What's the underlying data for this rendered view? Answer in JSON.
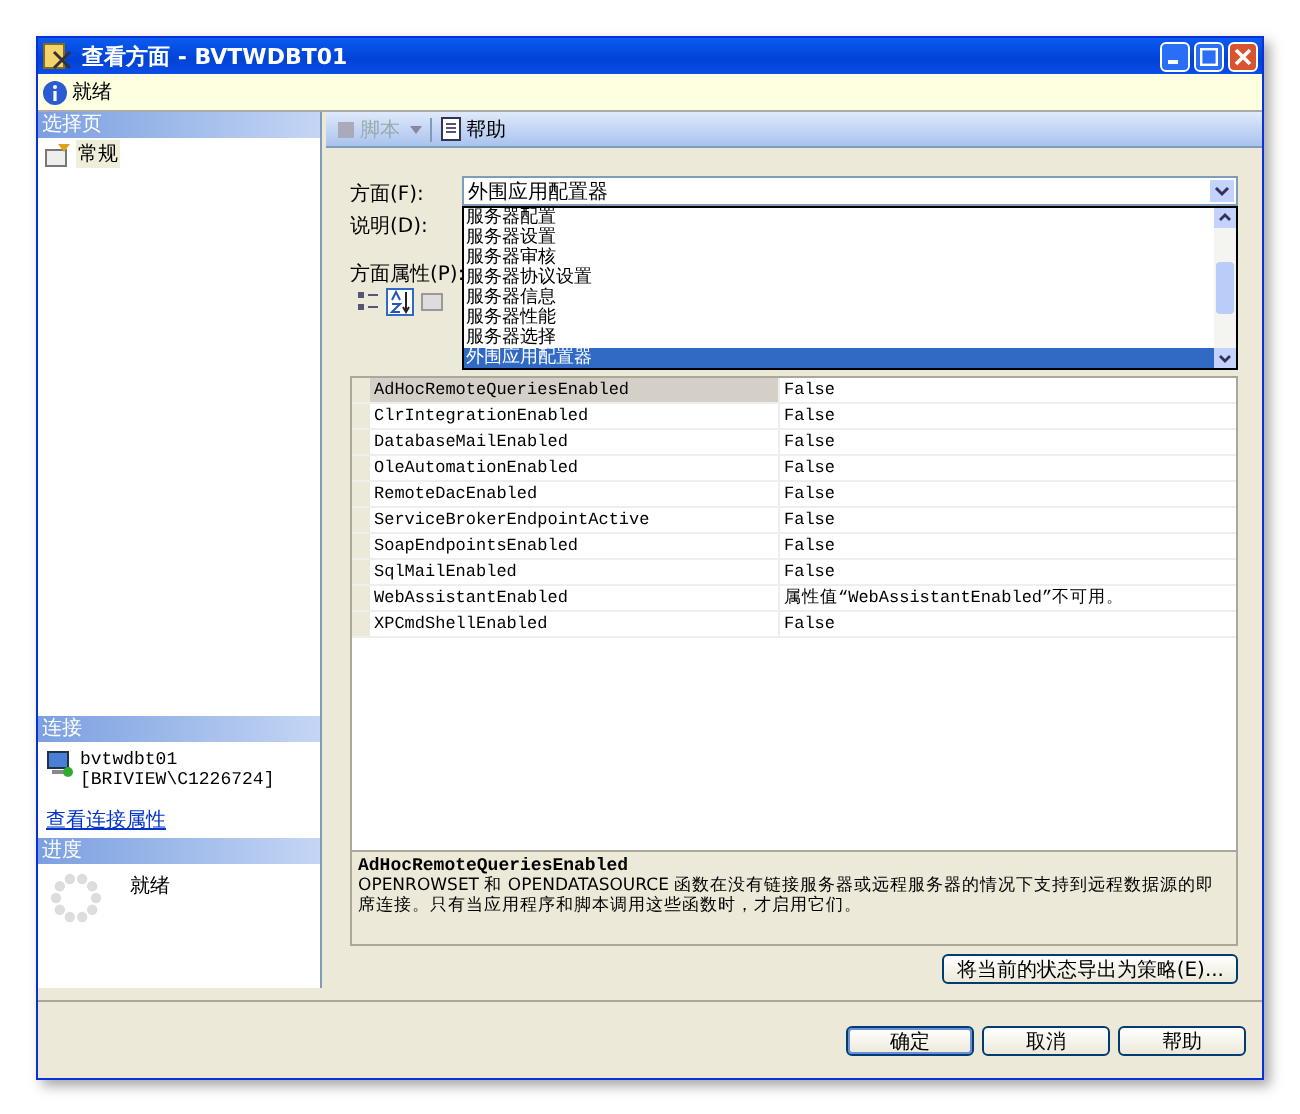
{
  "window": {
    "title": "查看方面 - BVTWDBT01"
  },
  "info_bar": {
    "text": "就绪"
  },
  "sidebar": {
    "pages_header": "选择页",
    "pages": [
      {
        "label": "常规",
        "selected": true
      }
    ],
    "connection_header": "连接",
    "connection": {
      "server": "bvtwdbt01",
      "user": "[BRIVIEW\\C1226724]"
    },
    "connection_link": "查看连接属性",
    "progress_header": "进度",
    "progress_status": "就绪"
  },
  "toolbar": [
    {
      "label": "脚本",
      "disabled": true,
      "kind": "script"
    },
    {
      "label": "帮助",
      "disabled": false,
      "kind": "help"
    }
  ],
  "form": {
    "facet_label": "方面(F):",
    "facet_value": "外围应用配置器",
    "description_label": "说明(D):",
    "properties_label": "方面属性(P):"
  },
  "dropdown": [
    {
      "label": "服务器配置",
      "selected": false
    },
    {
      "label": "服务器设置",
      "selected": false
    },
    {
      "label": "服务器审核",
      "selected": false
    },
    {
      "label": "服务器协议设置",
      "selected": false
    },
    {
      "label": "服务器信息",
      "selected": false
    },
    {
      "label": "服务器性能",
      "selected": false
    },
    {
      "label": "服务器选择",
      "selected": false
    },
    {
      "label": "外围应用配置器",
      "selected": true
    }
  ],
  "property_view": [
    {
      "kind": "categorized",
      "selected": false
    },
    {
      "kind": "alphabetical",
      "selected": true
    },
    {
      "kind": "pages",
      "selected": false
    }
  ],
  "properties": [
    {
      "name": "AdHocRemoteQueriesEnabled",
      "value": "False",
      "selected": true
    },
    {
      "name": "ClrIntegrationEnabled",
      "value": "False",
      "selected": false
    },
    {
      "name": "DatabaseMailEnabled",
      "value": "False",
      "selected": false
    },
    {
      "name": "OleAutomationEnabled",
      "value": "False",
      "selected": false
    },
    {
      "name": "RemoteDacEnabled",
      "value": "False",
      "selected": false
    },
    {
      "name": "ServiceBrokerEndpointActive",
      "value": "False",
      "selected": false
    },
    {
      "name": "SoapEndpointsEnabled",
      "value": "False",
      "selected": false
    },
    {
      "name": "SqlMailEnabled",
      "value": "False",
      "selected": false
    },
    {
      "name": "WebAssistantEnabled",
      "value": "属性值“WebAssistantEnabled”不可用。",
      "selected": false
    },
    {
      "name": "XPCmdShellEnabled",
      "value": "False",
      "selected": false
    }
  ],
  "description": {
    "title": "AdHocRemoteQueriesEnabled",
    "text": "OPENROWSET 和 OPENDATASOURCE 函数在没有链接服务器或远程服务器的情况下支持到远程数据源的即席连接。只有当应用程序和脚本调用这些函数时，才启用它们。"
  },
  "export_button": "将当前的状态导出为策略(E)...",
  "buttons": [
    "确定",
    "取消",
    "帮助"
  ]
}
